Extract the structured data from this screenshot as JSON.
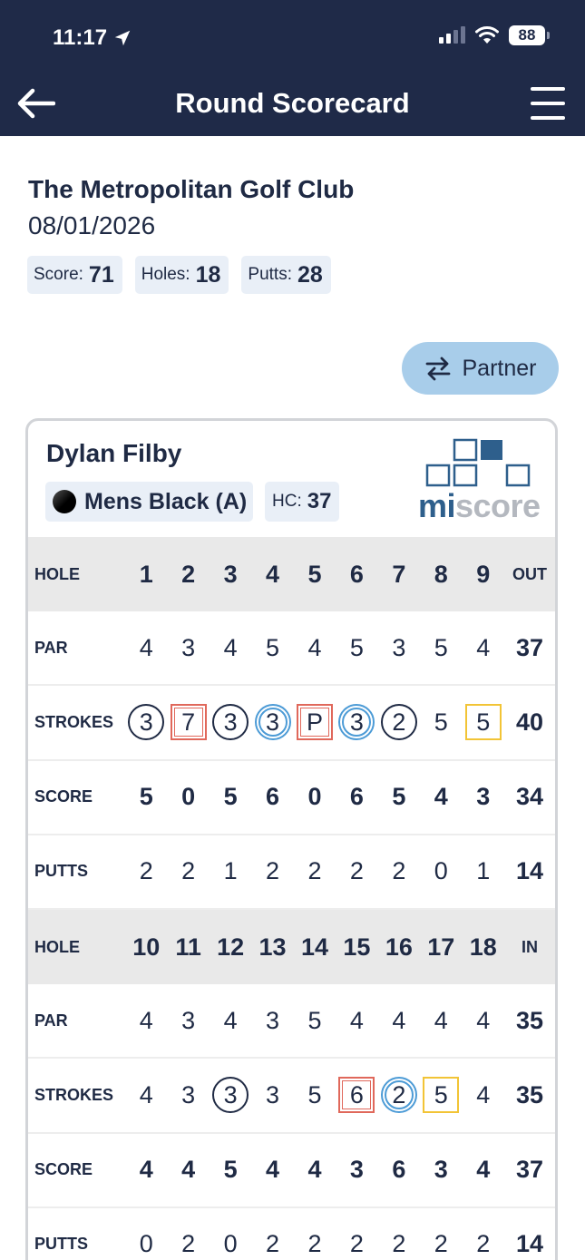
{
  "status": {
    "time": "11:17",
    "battery": "88",
    "icons": [
      "location-arrow-icon",
      "signal-icon",
      "wifi-icon",
      "battery-icon"
    ]
  },
  "nav": {
    "title": "Round Scorecard",
    "back_icon": "arrow-left-icon",
    "menu_icon": "hamburger-menu-icon"
  },
  "round": {
    "club": "The Metropolitan Golf Club",
    "date": "08/01/2026",
    "summary": [
      {
        "label": "Score:",
        "value": "71"
      },
      {
        "label": "Holes:",
        "value": "18"
      },
      {
        "label": "Putts:",
        "value": "28"
      }
    ]
  },
  "partner_button": {
    "label": "Partner",
    "icon": "swap-arrows-icon"
  },
  "player": {
    "name": "Dylan Filby",
    "tee": "Mens Black (A)",
    "hc_label": "HC:",
    "hc_value": "37",
    "logo": {
      "mi": "mi",
      "score": "score"
    }
  },
  "colors": {
    "navy": "#1f2a48",
    "circle_blue": "#4c9bd6",
    "square_red": "#e0685b",
    "square_yellow": "#f2c436",
    "chip_bg": "#e9eff7",
    "partner_bg": "#a8cdea"
  },
  "scorecard": {
    "front": {
      "rows": [
        {
          "label": "HOLE",
          "type": "header",
          "cells": [
            "1",
            "2",
            "3",
            "4",
            "5",
            "6",
            "7",
            "8",
            "9"
          ],
          "total": "OUT",
          "total_small": true
        },
        {
          "label": "PAR",
          "type": "plain",
          "cells": [
            "4",
            "3",
            "4",
            "5",
            "4",
            "5",
            "3",
            "5",
            "4"
          ],
          "total": "37"
        },
        {
          "label": "STROKES",
          "type": "strokes",
          "cells": [
            "3",
            "7",
            "3",
            "3",
            "P",
            "3",
            "2",
            "5",
            "5"
          ],
          "marks": [
            "circle",
            "double-square",
            "circle",
            "double-circle",
            "double-square",
            "double-circle",
            "circle",
            "none",
            "yellow-square"
          ],
          "total": "40"
        },
        {
          "label": "SCORE",
          "type": "bold",
          "cells": [
            "5",
            "0",
            "5",
            "6",
            "0",
            "6",
            "5",
            "4",
            "3"
          ],
          "total": "34"
        },
        {
          "label": "PUTTS",
          "type": "plain",
          "cells": [
            "2",
            "2",
            "1",
            "2",
            "2",
            "2",
            "2",
            "0",
            "1"
          ],
          "total": "14"
        }
      ]
    },
    "back": {
      "rows": [
        {
          "label": "HOLE",
          "type": "header",
          "cells": [
            "10",
            "11",
            "12",
            "13",
            "14",
            "15",
            "16",
            "17",
            "18"
          ],
          "total": "IN",
          "total_small": true
        },
        {
          "label": "PAR",
          "type": "plain",
          "cells": [
            "4",
            "3",
            "4",
            "3",
            "5",
            "4",
            "4",
            "4",
            "4"
          ],
          "total": "35"
        },
        {
          "label": "STROKES",
          "type": "strokes",
          "cells": [
            "4",
            "3",
            "3",
            "3",
            "5",
            "6",
            "2",
            "5",
            "4"
          ],
          "marks": [
            "none",
            "none",
            "circle",
            "none",
            "none",
            "double-square",
            "double-circle",
            "yellow-square",
            "none"
          ],
          "total": "35"
        },
        {
          "label": "SCORE",
          "type": "bold",
          "cells": [
            "4",
            "4",
            "5",
            "4",
            "4",
            "3",
            "6",
            "3",
            "4"
          ],
          "total": "37"
        },
        {
          "label": "PUTTS",
          "type": "plain",
          "cells": [
            "0",
            "2",
            "0",
            "2",
            "2",
            "2",
            "2",
            "2",
            "2"
          ],
          "total": "14"
        }
      ]
    }
  }
}
